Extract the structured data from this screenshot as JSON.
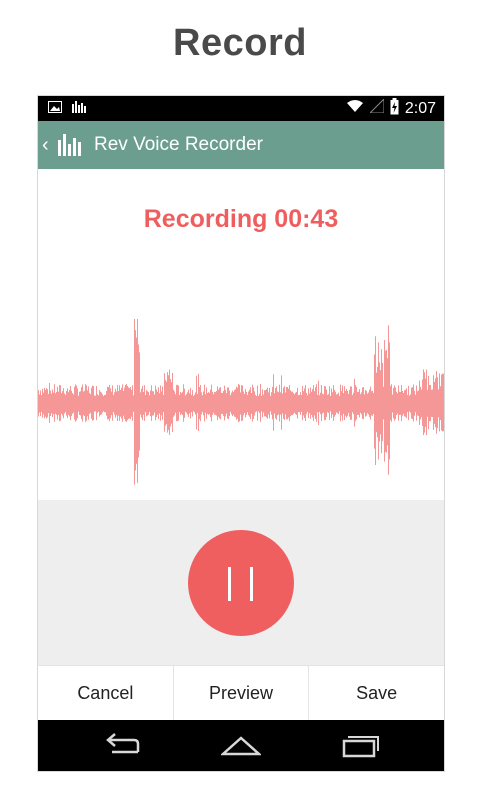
{
  "page": {
    "title": "Record"
  },
  "status_bar": {
    "time": "2:07",
    "icons": [
      "image-icon",
      "signal-bars-icon",
      "wifi-icon",
      "cell-signal-icon",
      "battery-charging-icon"
    ]
  },
  "app_bar": {
    "title": "Rev Voice Recorder",
    "back_icon": "chevron-left-icon",
    "app_icon": "waveform-bars-icon",
    "color": "#6b9e8f"
  },
  "recorder": {
    "status": "Recording 00:43",
    "state_color": "#ef5e5e",
    "waveform_color": "#f59797",
    "pause_icon": "pause-icon"
  },
  "actions": {
    "cancel": "Cancel",
    "preview": "Preview",
    "save": "Save"
  },
  "nav": {
    "back_icon": "back-arrow-icon",
    "home_icon": "home-icon",
    "recents_icon": "recent-apps-icon"
  }
}
